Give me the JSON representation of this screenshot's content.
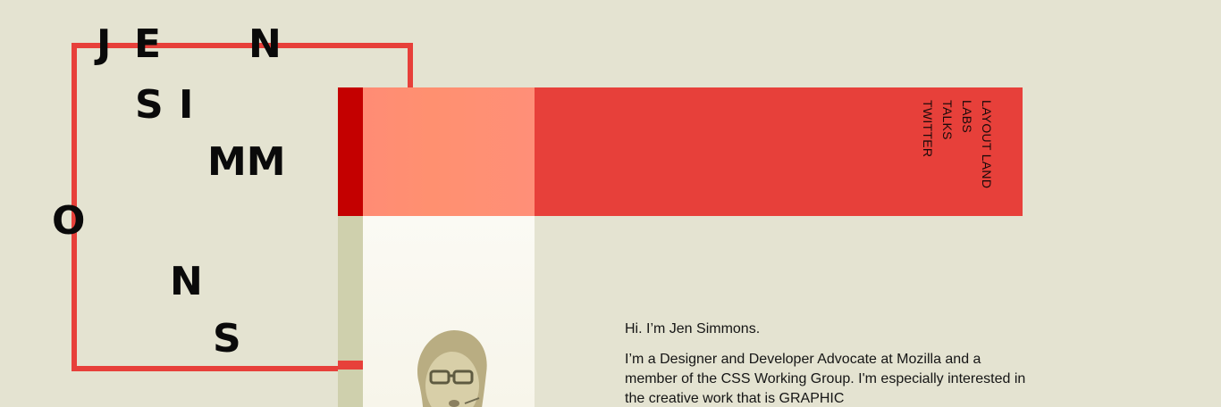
{
  "logo": {
    "letters": [
      "J",
      "E",
      "N",
      "S",
      "I",
      "MM",
      "O",
      "N",
      "S"
    ]
  },
  "nav": {
    "items": [
      "LAYOUT LAND",
      "LABS",
      "TALKS",
      "TWITTER"
    ]
  },
  "intro": {
    "greeting": "Hi. I’m Jen Simmons.",
    "bio": "I’m a Designer and Developer Advocate at Mozilla and a member of the CSS Working Group. I'm especially interested in the creative work that is GRAPHIC"
  },
  "colors": {
    "background": "#e4e3d1",
    "accent_red": "#e7403a",
    "dark_red": "#c40000",
    "light_red": "#ff8c75",
    "olive": "#cfd0ad"
  },
  "portrait": {
    "icon": "person-photo"
  }
}
